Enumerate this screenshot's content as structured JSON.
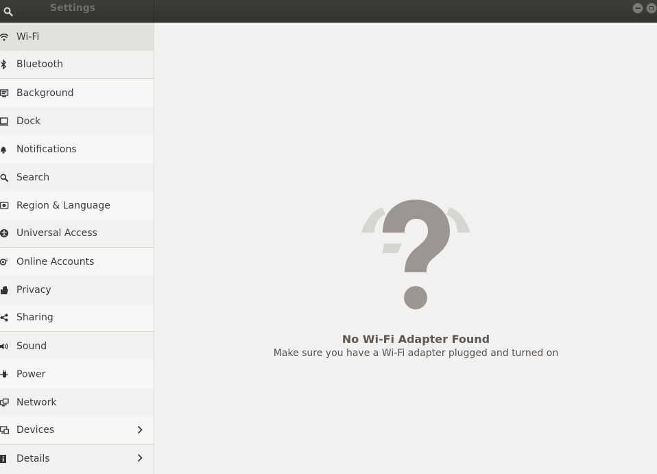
{
  "header": {
    "title": "Settings"
  },
  "sidebar": {
    "items": [
      {
        "label": "Wi-Fi",
        "icon": "wifi-icon"
      },
      {
        "label": "Bluetooth",
        "icon": "bluetooth-icon"
      },
      {
        "label": "Background",
        "icon": "background-icon"
      },
      {
        "label": "Dock",
        "icon": "dock-icon"
      },
      {
        "label": "Notifications",
        "icon": "bell-icon"
      },
      {
        "label": "Search",
        "icon": "search-icon"
      },
      {
        "label": "Region & Language",
        "icon": "region-icon"
      },
      {
        "label": "Universal Access",
        "icon": "accessibility-icon"
      },
      {
        "label": "Online Accounts",
        "icon": "online-accounts-icon"
      },
      {
        "label": "Privacy",
        "icon": "privacy-hand-icon"
      },
      {
        "label": "Sharing",
        "icon": "share-icon"
      },
      {
        "label": "Sound",
        "icon": "speaker-icon"
      },
      {
        "label": "Power",
        "icon": "power-icon"
      },
      {
        "label": "Network",
        "icon": "network-icon"
      },
      {
        "label": "Devices",
        "icon": "devices-icon"
      },
      {
        "label": "Details",
        "icon": "info-icon"
      }
    ]
  },
  "main": {
    "empty_title": "No Wi-Fi Adapter Found",
    "empty_subtitle": "Make sure you have a Wi-Fi adapter plugged and turned on"
  }
}
